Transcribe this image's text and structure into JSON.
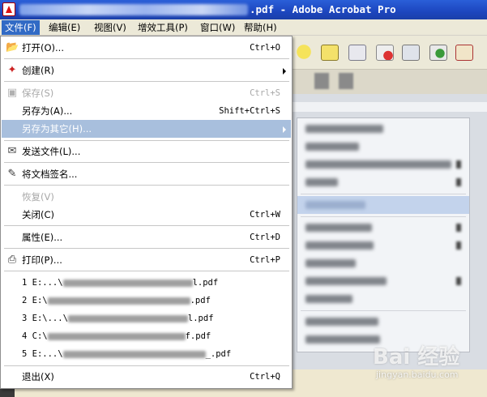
{
  "window": {
    "title_suffix": ".pdf - Adobe Acrobat Pro"
  },
  "menubar": {
    "items": [
      {
        "label": "文件(F)"
      },
      {
        "label": "编辑(E)"
      },
      {
        "label": "视图(V)"
      },
      {
        "label": "增效工具(P)"
      },
      {
        "label": "窗口(W)"
      },
      {
        "label": "帮助(H)"
      }
    ]
  },
  "file_menu": {
    "open": {
      "label": "打开(O)...",
      "shortcut": "Ctrl+O",
      "icon": "open-folder-icon"
    },
    "create": {
      "label": "创建(R)",
      "icon": "create-pdf-icon"
    },
    "save": {
      "label": "保存(S)",
      "shortcut": "Ctrl+S",
      "icon": "save-icon"
    },
    "save_as": {
      "label": "另存为(A)...",
      "shortcut": "Shift+Ctrl+S"
    },
    "save_as_other": {
      "label": "另存为其它(H)..."
    },
    "send_file": {
      "label": "发送文件(L)...",
      "icon": "envelope-icon"
    },
    "sign_document": {
      "label": "将文档签名...",
      "icon": "sign-pen-icon"
    },
    "revert": {
      "label": "恢复(V)"
    },
    "close": {
      "label": "关闭(C)",
      "shortcut": "Ctrl+W"
    },
    "properties": {
      "label": "属性(E)...",
      "shortcut": "Ctrl+D"
    },
    "print": {
      "label": "打印(P)...",
      "shortcut": "Ctrl+P",
      "icon": "printer-icon"
    },
    "recent_files": [
      {
        "prefix": "1 E:...\\",
        "suffix": "l.pdf"
      },
      {
        "prefix": "2 E:\\",
        "suffix": ".pdf"
      },
      {
        "prefix": "3 E:\\...\\",
        "suffix": "l.pdf"
      },
      {
        "prefix": "4 C:\\",
        "suffix": "f.pdf"
      },
      {
        "prefix": "5 E:...\\",
        "suffix": "_.pdf"
      }
    ],
    "exit": {
      "label": "退出(X)",
      "shortcut": "Ctrl+Q"
    }
  },
  "watermark": {
    "main": "Bai 经验",
    "sub": "jingyan.baidu.com"
  },
  "colors": {
    "titlebar": "#1d46bf",
    "menu_active": "#316ac5",
    "menu_highlight": "#a8bfdd",
    "menubar_bg": "#ece9d8"
  }
}
